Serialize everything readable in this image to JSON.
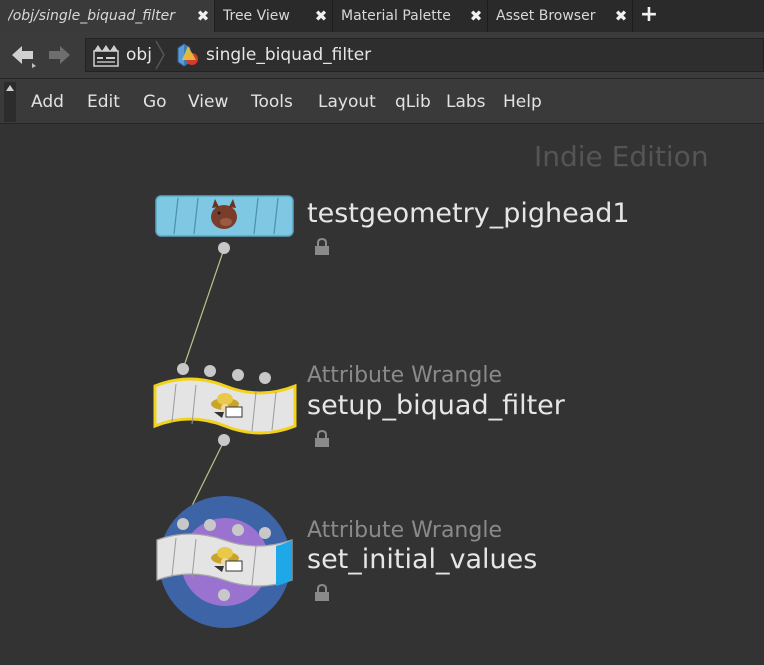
{
  "tabs": [
    {
      "label": "/obj/single_biquad_filter",
      "active": true
    },
    {
      "label": "Tree View",
      "active": false
    },
    {
      "label": "Material Palette",
      "active": false
    },
    {
      "label": "Asset Browser",
      "active": false
    }
  ],
  "tab_close_glyph": "✖",
  "tab_add_glyph": "+",
  "path": {
    "root": "obj",
    "current": "single_biquad_filter"
  },
  "menu": [
    "Add",
    "Edit",
    "Go",
    "View",
    "Tools",
    "Layout",
    "qLib",
    "Labs",
    "Help"
  ],
  "watermark": "Indie Edition",
  "nodes": [
    {
      "name": "testgeometry_pighead1",
      "type": ""
    },
    {
      "name": "setup_biquad_filter",
      "type": "Attribute Wrangle"
    },
    {
      "name": "set_initial_values",
      "type": "Attribute Wrangle"
    }
  ],
  "colors": {
    "node_geometry": "#7ec8e3",
    "selected_outline": "#f2d21b",
    "ring_outer": "#3e64a8",
    "ring_inner": "#9a72cf",
    "display_flag": "#1ea8e8",
    "wire": "#b8c48a"
  }
}
